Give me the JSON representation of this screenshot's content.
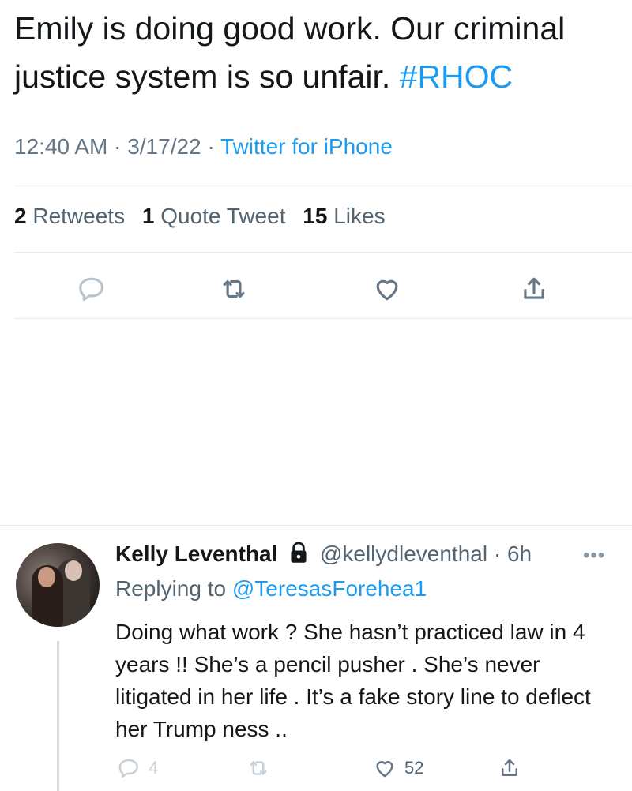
{
  "tweet": {
    "text": "Emily is doing good work. Our criminal justice system is so unfair.",
    "hashtag": "#RHOC",
    "time": "12:40 AM",
    "date": "3/17/22",
    "source": "Twitter for iPhone",
    "separator": "·"
  },
  "stats": {
    "retweets_count": "2",
    "retweets_label": "Retweets",
    "quotes_count": "1",
    "quotes_label": "Quote Tweet",
    "likes_count": "15",
    "likes_label": "Likes"
  },
  "icons": {
    "reply": "reply-icon",
    "retweet": "retweet-icon",
    "like": "heart-icon",
    "share": "share-icon",
    "lock": "lock-icon",
    "more": "more-icon"
  },
  "reply": {
    "name": "Kelly Leventhal",
    "handle": "@kellydleventhal",
    "time": "6h",
    "separator": "·",
    "replying_prefix": "Replying to",
    "replying_to": "@TeresasForehea1",
    "text": "Doing what work ? She hasn’t practiced law in 4 years !! She’s a pencil pusher .  She’s never litigated in her life . It’s a fake story line to deflect her Trump ness ..",
    "reply_count": "4",
    "like_count": "52",
    "more_glyph": "•••"
  },
  "colors": {
    "accent": "#1d9bf0",
    "muted": "#657786",
    "text": "#14171a",
    "divider": "#e6ecf0"
  }
}
